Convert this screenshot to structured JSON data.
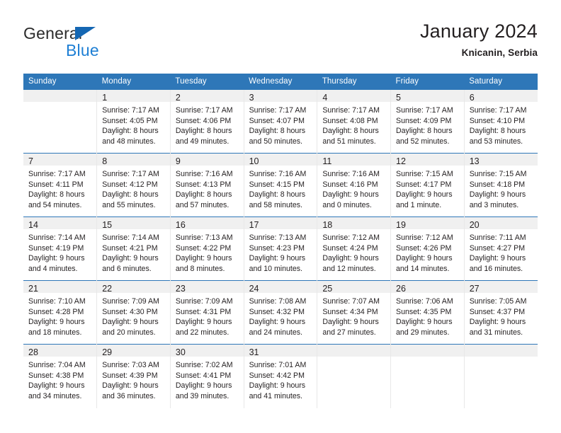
{
  "brand": {
    "name_top": "General",
    "name_bottom": "Blue",
    "triangle_icon": "triangle-icon",
    "accent_color": "#1567b3",
    "blue_text_color": "#1e7fd4"
  },
  "header": {
    "title": "January 2024",
    "subtitle": "Knicanin, Serbia"
  },
  "theme": {
    "header_row_color": "#2e77b8",
    "daynum_band_color": "#f0f0f0",
    "text_color": "#231f20"
  },
  "weekday_headers": [
    "Sunday",
    "Monday",
    "Tuesday",
    "Wednesday",
    "Thursday",
    "Friday",
    "Saturday"
  ],
  "weeks": [
    [
      {
        "day": "",
        "lines": []
      },
      {
        "day": "1",
        "lines": [
          "Sunrise: 7:17 AM",
          "Sunset: 4:05 PM",
          "Daylight: 8 hours",
          "and 48 minutes."
        ]
      },
      {
        "day": "2",
        "lines": [
          "Sunrise: 7:17 AM",
          "Sunset: 4:06 PM",
          "Daylight: 8 hours",
          "and 49 minutes."
        ]
      },
      {
        "day": "3",
        "lines": [
          "Sunrise: 7:17 AM",
          "Sunset: 4:07 PM",
          "Daylight: 8 hours",
          "and 50 minutes."
        ]
      },
      {
        "day": "4",
        "lines": [
          "Sunrise: 7:17 AM",
          "Sunset: 4:08 PM",
          "Daylight: 8 hours",
          "and 51 minutes."
        ]
      },
      {
        "day": "5",
        "lines": [
          "Sunrise: 7:17 AM",
          "Sunset: 4:09 PM",
          "Daylight: 8 hours",
          "and 52 minutes."
        ]
      },
      {
        "day": "6",
        "lines": [
          "Sunrise: 7:17 AM",
          "Sunset: 4:10 PM",
          "Daylight: 8 hours",
          "and 53 minutes."
        ]
      }
    ],
    [
      {
        "day": "7",
        "lines": [
          "Sunrise: 7:17 AM",
          "Sunset: 4:11 PM",
          "Daylight: 8 hours",
          "and 54 minutes."
        ]
      },
      {
        "day": "8",
        "lines": [
          "Sunrise: 7:17 AM",
          "Sunset: 4:12 PM",
          "Daylight: 8 hours",
          "and 55 minutes."
        ]
      },
      {
        "day": "9",
        "lines": [
          "Sunrise: 7:16 AM",
          "Sunset: 4:13 PM",
          "Daylight: 8 hours",
          "and 57 minutes."
        ]
      },
      {
        "day": "10",
        "lines": [
          "Sunrise: 7:16 AM",
          "Sunset: 4:15 PM",
          "Daylight: 8 hours",
          "and 58 minutes."
        ]
      },
      {
        "day": "11",
        "lines": [
          "Sunrise: 7:16 AM",
          "Sunset: 4:16 PM",
          "Daylight: 9 hours",
          "and 0 minutes."
        ]
      },
      {
        "day": "12",
        "lines": [
          "Sunrise: 7:15 AM",
          "Sunset: 4:17 PM",
          "Daylight: 9 hours",
          "and 1 minute."
        ]
      },
      {
        "day": "13",
        "lines": [
          "Sunrise: 7:15 AM",
          "Sunset: 4:18 PM",
          "Daylight: 9 hours",
          "and 3 minutes."
        ]
      }
    ],
    [
      {
        "day": "14",
        "lines": [
          "Sunrise: 7:14 AM",
          "Sunset: 4:19 PM",
          "Daylight: 9 hours",
          "and 4 minutes."
        ]
      },
      {
        "day": "15",
        "lines": [
          "Sunrise: 7:14 AM",
          "Sunset: 4:21 PM",
          "Daylight: 9 hours",
          "and 6 minutes."
        ]
      },
      {
        "day": "16",
        "lines": [
          "Sunrise: 7:13 AM",
          "Sunset: 4:22 PM",
          "Daylight: 9 hours",
          "and 8 minutes."
        ]
      },
      {
        "day": "17",
        "lines": [
          "Sunrise: 7:13 AM",
          "Sunset: 4:23 PM",
          "Daylight: 9 hours",
          "and 10 minutes."
        ]
      },
      {
        "day": "18",
        "lines": [
          "Sunrise: 7:12 AM",
          "Sunset: 4:24 PM",
          "Daylight: 9 hours",
          "and 12 minutes."
        ]
      },
      {
        "day": "19",
        "lines": [
          "Sunrise: 7:12 AM",
          "Sunset: 4:26 PM",
          "Daylight: 9 hours",
          "and 14 minutes."
        ]
      },
      {
        "day": "20",
        "lines": [
          "Sunrise: 7:11 AM",
          "Sunset: 4:27 PM",
          "Daylight: 9 hours",
          "and 16 minutes."
        ]
      }
    ],
    [
      {
        "day": "21",
        "lines": [
          "Sunrise: 7:10 AM",
          "Sunset: 4:28 PM",
          "Daylight: 9 hours",
          "and 18 minutes."
        ]
      },
      {
        "day": "22",
        "lines": [
          "Sunrise: 7:09 AM",
          "Sunset: 4:30 PM",
          "Daylight: 9 hours",
          "and 20 minutes."
        ]
      },
      {
        "day": "23",
        "lines": [
          "Sunrise: 7:09 AM",
          "Sunset: 4:31 PM",
          "Daylight: 9 hours",
          "and 22 minutes."
        ]
      },
      {
        "day": "24",
        "lines": [
          "Sunrise: 7:08 AM",
          "Sunset: 4:32 PM",
          "Daylight: 9 hours",
          "and 24 minutes."
        ]
      },
      {
        "day": "25",
        "lines": [
          "Sunrise: 7:07 AM",
          "Sunset: 4:34 PM",
          "Daylight: 9 hours",
          "and 27 minutes."
        ]
      },
      {
        "day": "26",
        "lines": [
          "Sunrise: 7:06 AM",
          "Sunset: 4:35 PM",
          "Daylight: 9 hours",
          "and 29 minutes."
        ]
      },
      {
        "day": "27",
        "lines": [
          "Sunrise: 7:05 AM",
          "Sunset: 4:37 PM",
          "Daylight: 9 hours",
          "and 31 minutes."
        ]
      }
    ],
    [
      {
        "day": "28",
        "lines": [
          "Sunrise: 7:04 AM",
          "Sunset: 4:38 PM",
          "Daylight: 9 hours",
          "and 34 minutes."
        ]
      },
      {
        "day": "29",
        "lines": [
          "Sunrise: 7:03 AM",
          "Sunset: 4:39 PM",
          "Daylight: 9 hours",
          "and 36 minutes."
        ]
      },
      {
        "day": "30",
        "lines": [
          "Sunrise: 7:02 AM",
          "Sunset: 4:41 PM",
          "Daylight: 9 hours",
          "and 39 minutes."
        ]
      },
      {
        "day": "31",
        "lines": [
          "Sunrise: 7:01 AM",
          "Sunset: 4:42 PM",
          "Daylight: 9 hours",
          "and 41 minutes."
        ]
      },
      {
        "day": "",
        "lines": []
      },
      {
        "day": "",
        "lines": []
      },
      {
        "day": "",
        "lines": []
      }
    ]
  ]
}
